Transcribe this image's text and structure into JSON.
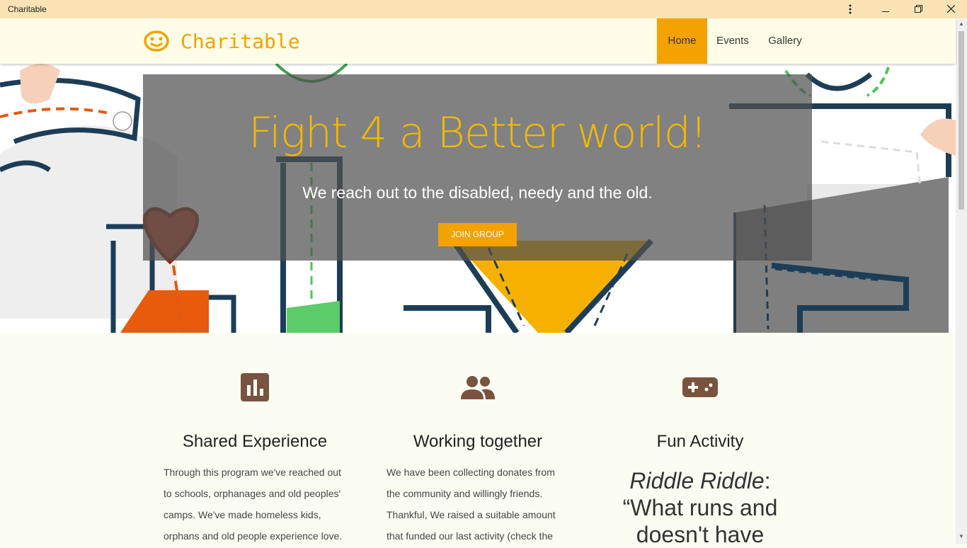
{
  "window": {
    "title": "Charitable"
  },
  "brand": {
    "name": "Charitable",
    "color": "#f3a200"
  },
  "nav": {
    "items": [
      {
        "label": "Home",
        "active": true
      },
      {
        "label": "Events",
        "active": false
      },
      {
        "label": "Gallery",
        "active": false
      }
    ]
  },
  "hero": {
    "title": "Fight 4 a Better world!",
    "subtitle": "We reach out to the disabled, needy and the old.",
    "button": "JOIN GROUP"
  },
  "features": [
    {
      "icon": "bar-chart-icon",
      "title": "Shared Experience",
      "body": "Through this program we've reached out to schools, orphanages and old peoples' camps. We've made homeless kids, orphans and old people experience love."
    },
    {
      "icon": "people-icon",
      "title": "Working together",
      "body": "We have been collecting donates from the community and willingly friends. Thankful, We raised a suitable amount that funded our last activity (check the"
    },
    {
      "icon": "gamepad-icon",
      "title": "Fun Activity",
      "riddle_label": "Riddle Riddle",
      "riddle_colon": ":",
      "riddle_text": "“What runs and doesn't have"
    }
  ],
  "colors": {
    "accent": "#f3a200",
    "icon": "#7a5240",
    "navbar": "#fffde8",
    "titlebar": "#fbe3b5"
  }
}
